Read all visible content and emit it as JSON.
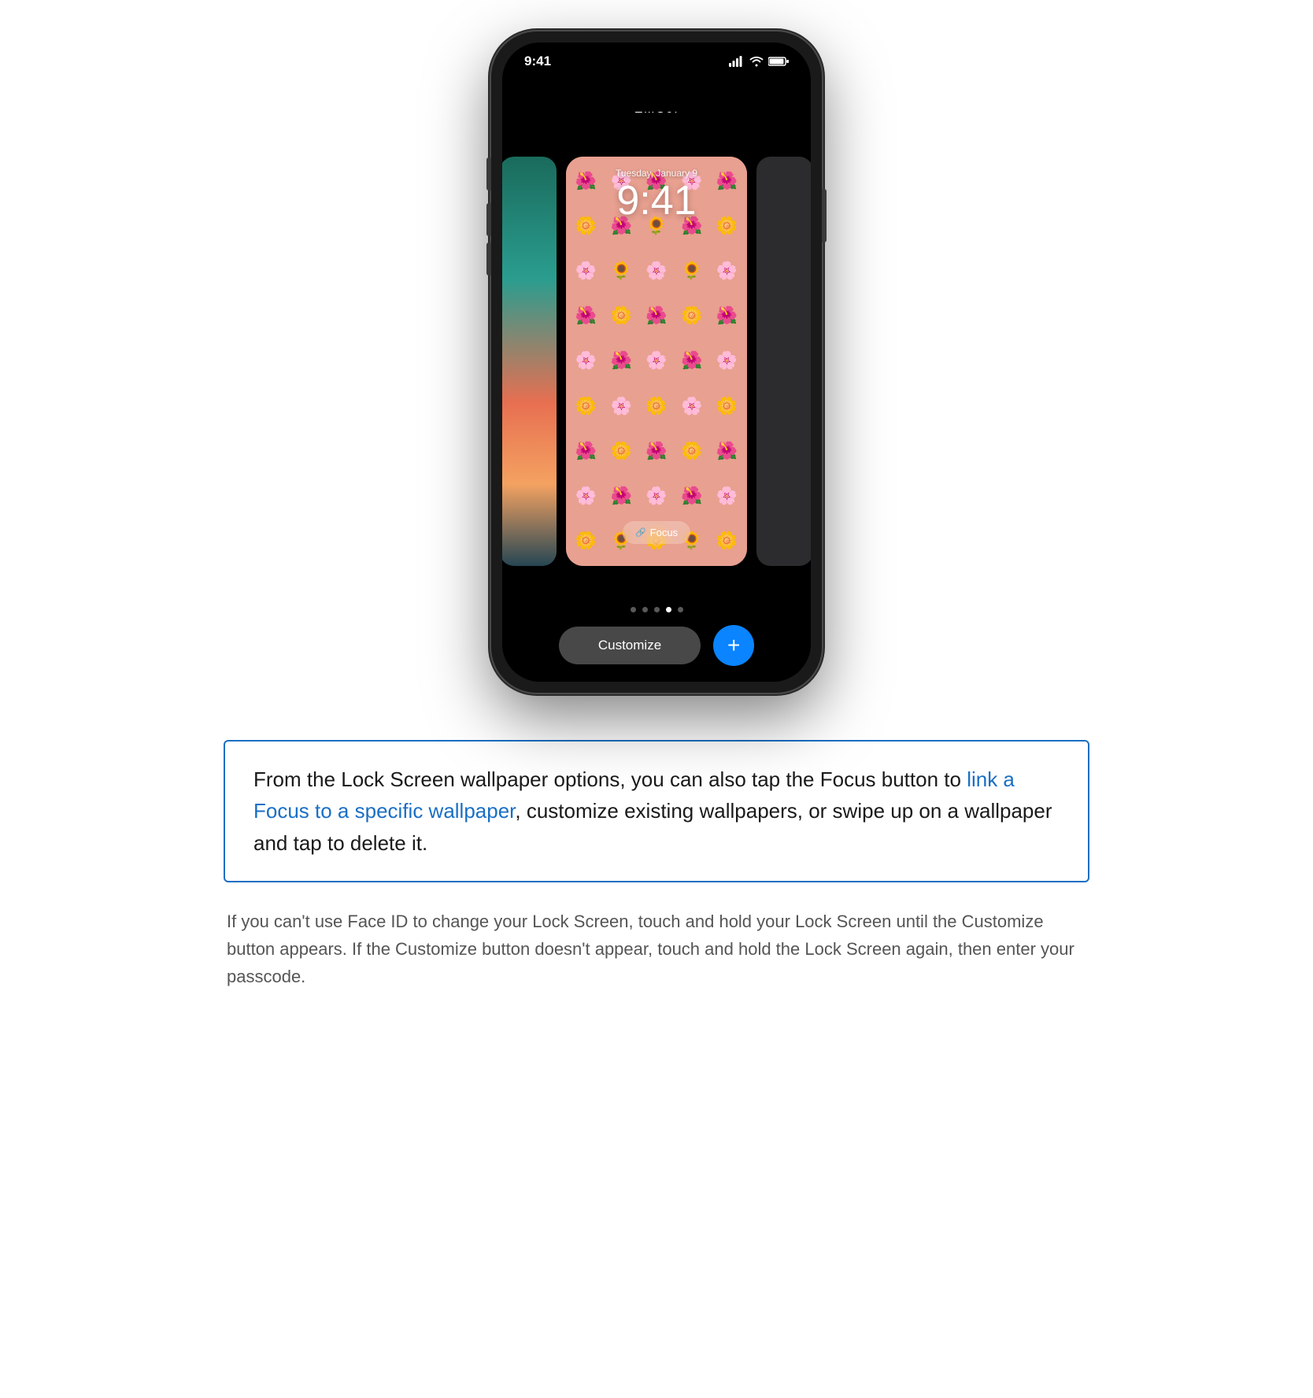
{
  "phone": {
    "status_time": "9:41",
    "signal_icon": "signal-bars",
    "wifi_icon": "wifi-icon",
    "battery_icon": "battery-icon",
    "wallpaper_label": "EMOJI",
    "lock_date": "Tuesday, January 9",
    "lock_time": "9:41",
    "focus_button_label": "Focus",
    "customize_label": "Customize",
    "add_label": "+",
    "flowers": [
      "🌸",
      "🌼",
      "🌺",
      "🌻",
      "🌸",
      "🌼",
      "🌺",
      "🌻",
      "🌸",
      "🌼",
      "🌺",
      "🌻",
      "🌸",
      "🌼",
      "🌺",
      "🌻",
      "🌸",
      "🌼",
      "🌺",
      "🌻",
      "🌸",
      "🌼",
      "🌺",
      "🌻",
      "🌸",
      "🌼",
      "🌺",
      "🌻",
      "🌸",
      "🌼",
      "🌺",
      "🌻",
      "🌸",
      "🌼",
      "🌺",
      "🌻",
      "🌸",
      "🌼",
      "🌺",
      "🌻",
      "🌸",
      "🌼",
      "🌺",
      "🌻",
      "🌸"
    ]
  },
  "highlight_paragraph": {
    "text_before": "From the Lock Screen wallpaper options, you can also tap the Focus button to ",
    "link_text": "link a Focus to a specific wallpaper",
    "text_after": ", customize existing wallpapers, or swipe up on a wallpaper and tap to delete it."
  },
  "normal_paragraph": {
    "text": "If you can't use Face ID to change your Lock Screen, touch and hold your Lock Screen until the Customize button appears. If the Customize button doesn't appear, touch and hold the Lock Screen again, then enter your passcode."
  }
}
